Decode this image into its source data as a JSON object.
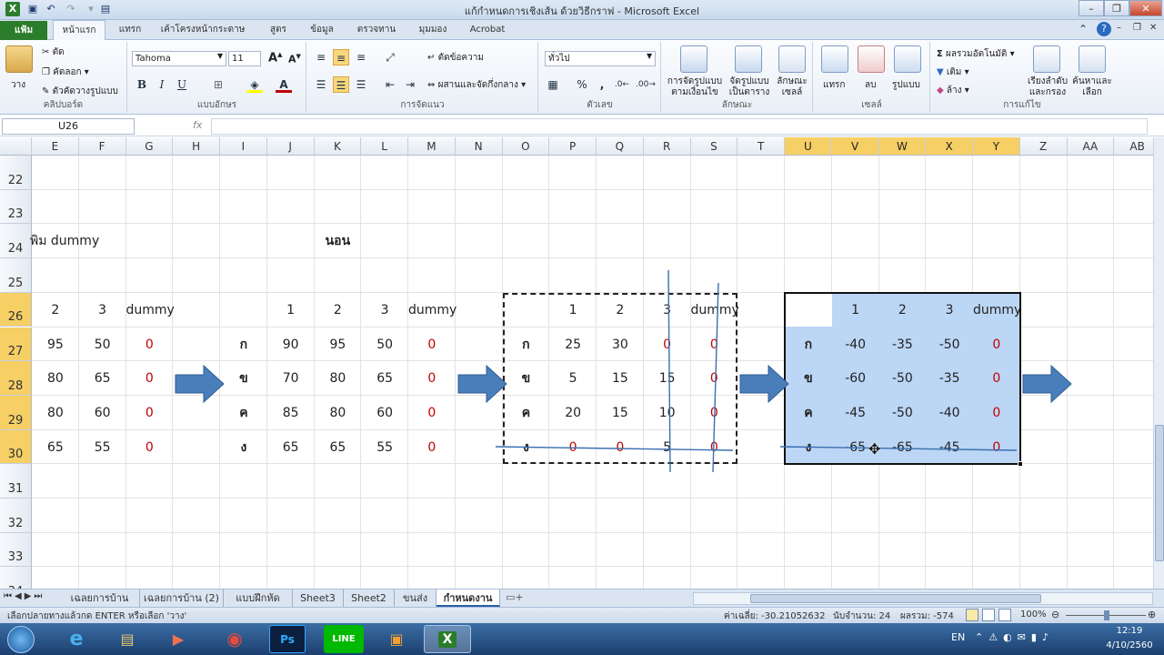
{
  "window": {
    "title": "แก้กำหนดการเชิงเส้น ด้วยวิธีกราฟ - Microsoft Excel"
  },
  "tabs": [
    "แฟ้ม",
    "หน้าแรก",
    "แทรก",
    "เค้าโครงหน้ากระดาษ",
    "สูตร",
    "ข้อมูล",
    "ตรวจทาน",
    "มุมมอง",
    "Acrobat"
  ],
  "ribbon": {
    "clipboard": {
      "paste": "วาง",
      "cut": "ตัด",
      "copy": "คัดลอก",
      "format_painter": "ตัวคัดวางรูปแบบ",
      "label": "คลิปบอร์ด"
    },
    "font": {
      "name": "Tahoma",
      "size": "11",
      "label": "แบบอักษร",
      "bold": "B",
      "italic": "I",
      "underline": "U"
    },
    "alignment": {
      "wrap": "ตัดข้อความ",
      "merge": "ผสานและจัดกึ่งกลาง",
      "label": "การจัดแนว"
    },
    "number": {
      "format": "ทั่วไป",
      "label": "ตัวเลข"
    },
    "styles": {
      "cond": "การจัดรูปแบบ ตามเงื่อนไข",
      "table": "จัดรูปแบบ เป็นตาราง",
      "cell": "ลักษณะ เซลล์",
      "label": "ลักษณะ"
    },
    "cells": {
      "insert": "แทรก",
      "delete": "ลบ",
      "format": "รูปแบบ",
      "label": "เซลล์"
    },
    "editing": {
      "autosum": "ผลรวมอัตโนมัติ",
      "fill": "เติม",
      "clear": "ล้าง",
      "sort": "เรียงลำดับ และกรอง",
      "find": "ค้นหาและ เลือก",
      "label": "การแก้ไข"
    }
  },
  "formula_bar": {
    "name_box": "U26",
    "fx": "fx",
    "value": ""
  },
  "columns": [
    "E",
    "F",
    "G",
    "H",
    "I",
    "J",
    "K",
    "L",
    "M",
    "N",
    "O",
    "P",
    "Q",
    "R",
    "S",
    "T",
    "U",
    "V",
    "W",
    "X",
    "Y",
    "Z",
    "AA",
    "AB"
  ],
  "rows": [
    "22",
    "23",
    "24",
    "25",
    "26",
    "27",
    "28",
    "29",
    "30",
    "31",
    "32",
    "33",
    "34"
  ],
  "cells": {
    "e24": "พิม dummy",
    "k24": "นอน",
    "t1": {
      "head": [
        "2",
        "3",
        "dummy"
      ],
      "rows": [
        [
          "95",
          "50",
          "0"
        ],
        [
          "80",
          "65",
          "0"
        ],
        [
          "80",
          "60",
          "0"
        ],
        [
          "65",
          "55",
          "0"
        ]
      ]
    },
    "t2": {
      "head": [
        "1",
        "2",
        "3",
        "dummy"
      ],
      "labels": [
        "ก",
        "ข",
        "ค",
        "ง"
      ],
      "rows": [
        [
          "90",
          "95",
          "50",
          "0"
        ],
        [
          "70",
          "80",
          "65",
          "0"
        ],
        [
          "85",
          "80",
          "60",
          "0"
        ],
        [
          "65",
          "65",
          "55",
          "0"
        ]
      ]
    },
    "t3": {
      "head": [
        "1",
        "2",
        "3",
        "dummy"
      ],
      "labels": [
        "ก",
        "ข",
        "ค",
        "ง"
      ],
      "rows": [
        [
          "25",
          "30",
          "0",
          "0"
        ],
        [
          "5",
          "15",
          "15",
          "0"
        ],
        [
          "20",
          "15",
          "10",
          "0"
        ],
        [
          "0",
          "0",
          "5",
          "0"
        ]
      ]
    },
    "t4": {
      "head": [
        "1",
        "2",
        "3",
        "dummy"
      ],
      "labels": [
        "ก",
        "ข",
        "ค",
        "ง"
      ],
      "rows": [
        [
          "-40",
          "-35",
          "-50",
          "0"
        ],
        [
          "-60",
          "-50",
          "-35",
          "0"
        ],
        [
          "-45",
          "-50",
          "-40",
          "0"
        ],
        [
          "-65",
          "-65",
          "-45",
          "0"
        ]
      ]
    }
  },
  "sheet_tabs": [
    "เฉลยการบ้าน",
    "เฉลยการบ้าน (2)",
    "แบบฝึกหัด",
    "Sheet3",
    "Sheet2",
    "ขนส่ง",
    "กำหนดงาน"
  ],
  "status": {
    "message": "เลือกปลายทางแล้วกด ENTER หรือเลือก 'วาง'",
    "average": "ค่าเฉลี่ย: -30.21052632",
    "count": "นับจำนวน: 24",
    "sum": "ผลรวม: -574",
    "zoom": "100%"
  },
  "taskbar": {
    "lang": "EN",
    "time": "12:19",
    "date": "4/10/2560"
  },
  "colors": {
    "selection_blue": "#bcd6f5",
    "arrow_blue": "#4a7ebb",
    "header_selected": "#f6cf65",
    "excel_green": "#2b7d2b"
  }
}
